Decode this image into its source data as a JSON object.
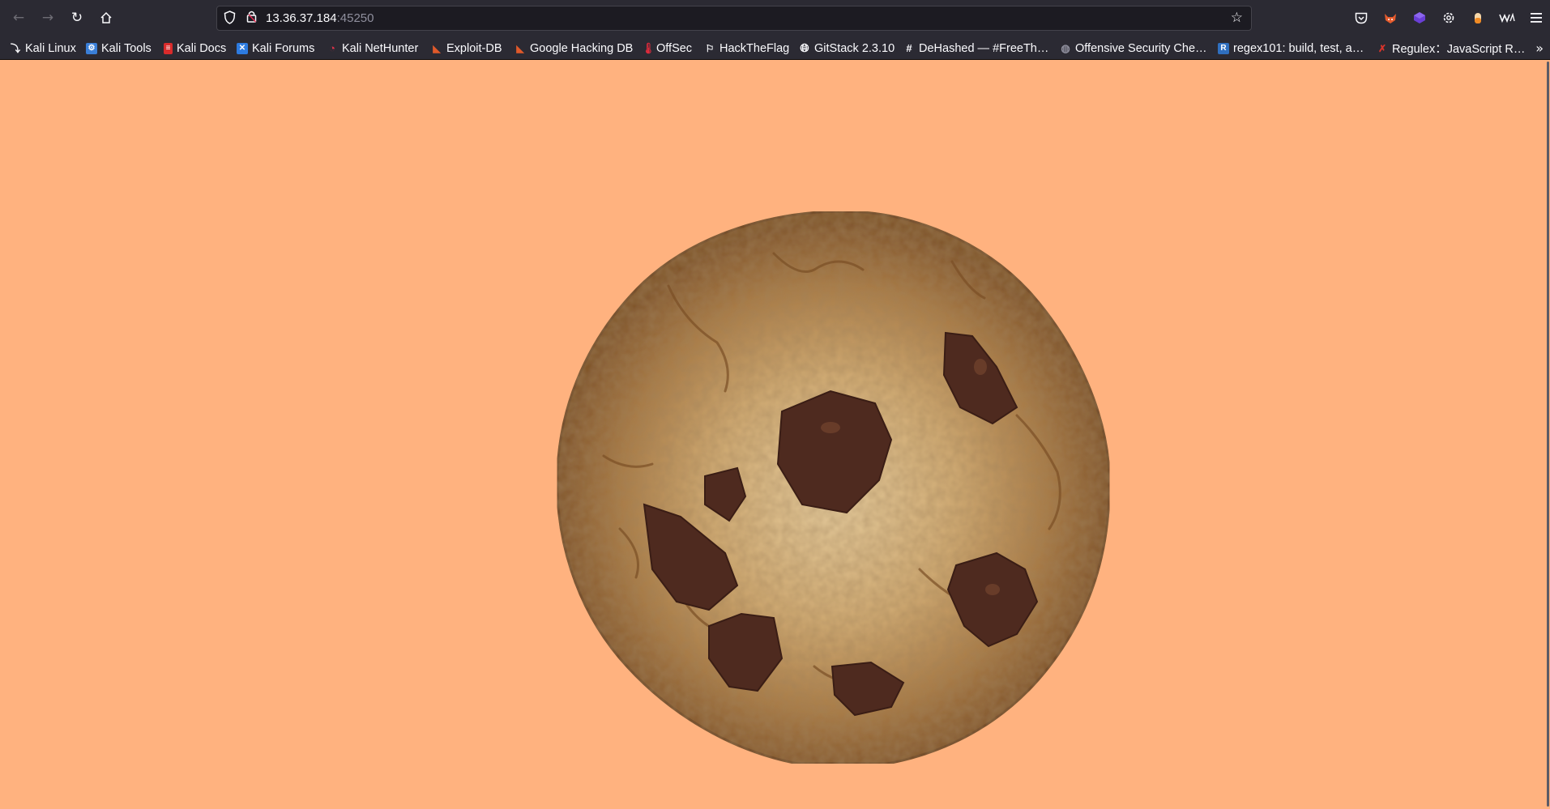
{
  "browser": {
    "url_host": "13.36.37.184",
    "url_port": ":45250",
    "icons": {
      "back": "arrow-left-icon",
      "forward": "arrow-right-icon",
      "reload": "reload-icon",
      "home": "home-icon",
      "shield": "shield-icon",
      "lock": "lock-icon",
      "star": "star-icon",
      "menu": "hamburger-menu-icon"
    }
  },
  "extensions": [
    "pocket-icon",
    "foxyproxy-icon",
    "extension-cube-icon",
    "settings-gear-icon",
    "extension-icon",
    "wappalyzer-icon"
  ],
  "bookmarks": [
    {
      "label": "Kali Linux",
      "icon": "kali-dragon-icon"
    },
    {
      "label": "Kali Tools",
      "icon": "kali-tools-icon"
    },
    {
      "label": "Kali Docs",
      "icon": "kali-docs-icon"
    },
    {
      "label": "Kali Forums",
      "icon": "kali-forums-icon"
    },
    {
      "label": "Kali NetHunter",
      "icon": "nethunter-icon"
    },
    {
      "label": "Exploit-DB",
      "icon": "exploit-db-icon"
    },
    {
      "label": "Google Hacking DB",
      "icon": "ghdb-icon"
    },
    {
      "label": "OffSec",
      "icon": "offsec-icon"
    },
    {
      "label": "HackTheFlag",
      "icon": "flag-icon"
    },
    {
      "label": "GitStack 2.3.10",
      "icon": "globe-icon"
    },
    {
      "label": "DeHashed — #FreeTh…",
      "icon": "hash-icon"
    },
    {
      "label": "Offensive Security Che…",
      "icon": "cheatsheet-icon"
    },
    {
      "label": "regex101: build, test, a…",
      "icon": "regex101-icon"
    },
    {
      "label": "Regulex：JavaScript R…",
      "icon": "regulex-icon"
    }
  ],
  "page": {
    "background_color": "#ffb27f",
    "image": "chocolate-chip-cookie"
  }
}
